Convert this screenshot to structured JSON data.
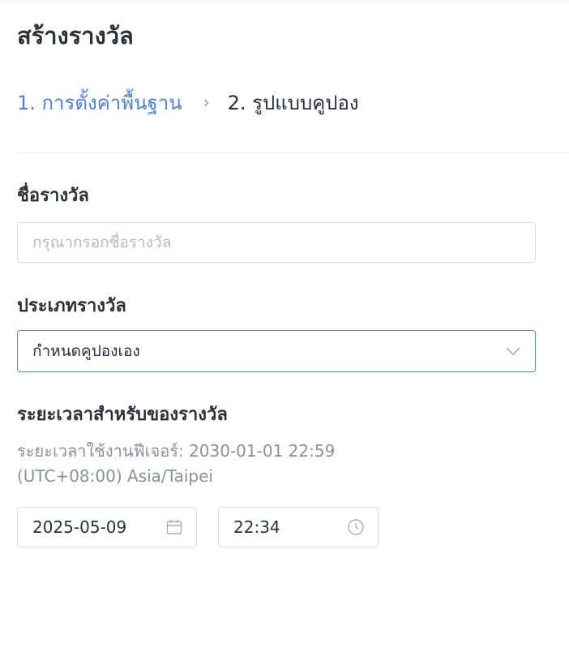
{
  "page": {
    "title": "สร้างรางวัล"
  },
  "steps": {
    "step1": "1. การตั้งค่าพื้นฐาน",
    "separator": "›",
    "step2": "2. รูปแบบคูปอง"
  },
  "reward_name": {
    "label": "ชื่อรางวัล",
    "value": "",
    "placeholder": "กรุณากรอกชื่อรางวัล"
  },
  "reward_type": {
    "label": "ประเภทรางวัล",
    "selected": "กำหนดคูปองเอง"
  },
  "reward_duration": {
    "label": "ระยะเวลาสำหรับของรางวัล",
    "hint_line1": "ระยะเวลาใช้งานฟีเจอร์: 2030-01-01 22:59",
    "hint_line2": "(UTC+08:00) Asia/Taipei",
    "date": "2025-05-09",
    "time": "22:34"
  },
  "colors": {
    "accent": "#4f7fd9",
    "text": "#2b2f36",
    "muted": "#8a8f99",
    "border": "#d9dce1",
    "focus_border": "#5b86d8"
  },
  "icons": {
    "select_arrow": "chevron-down-icon",
    "date": "calendar-icon",
    "time": "clock-icon"
  }
}
